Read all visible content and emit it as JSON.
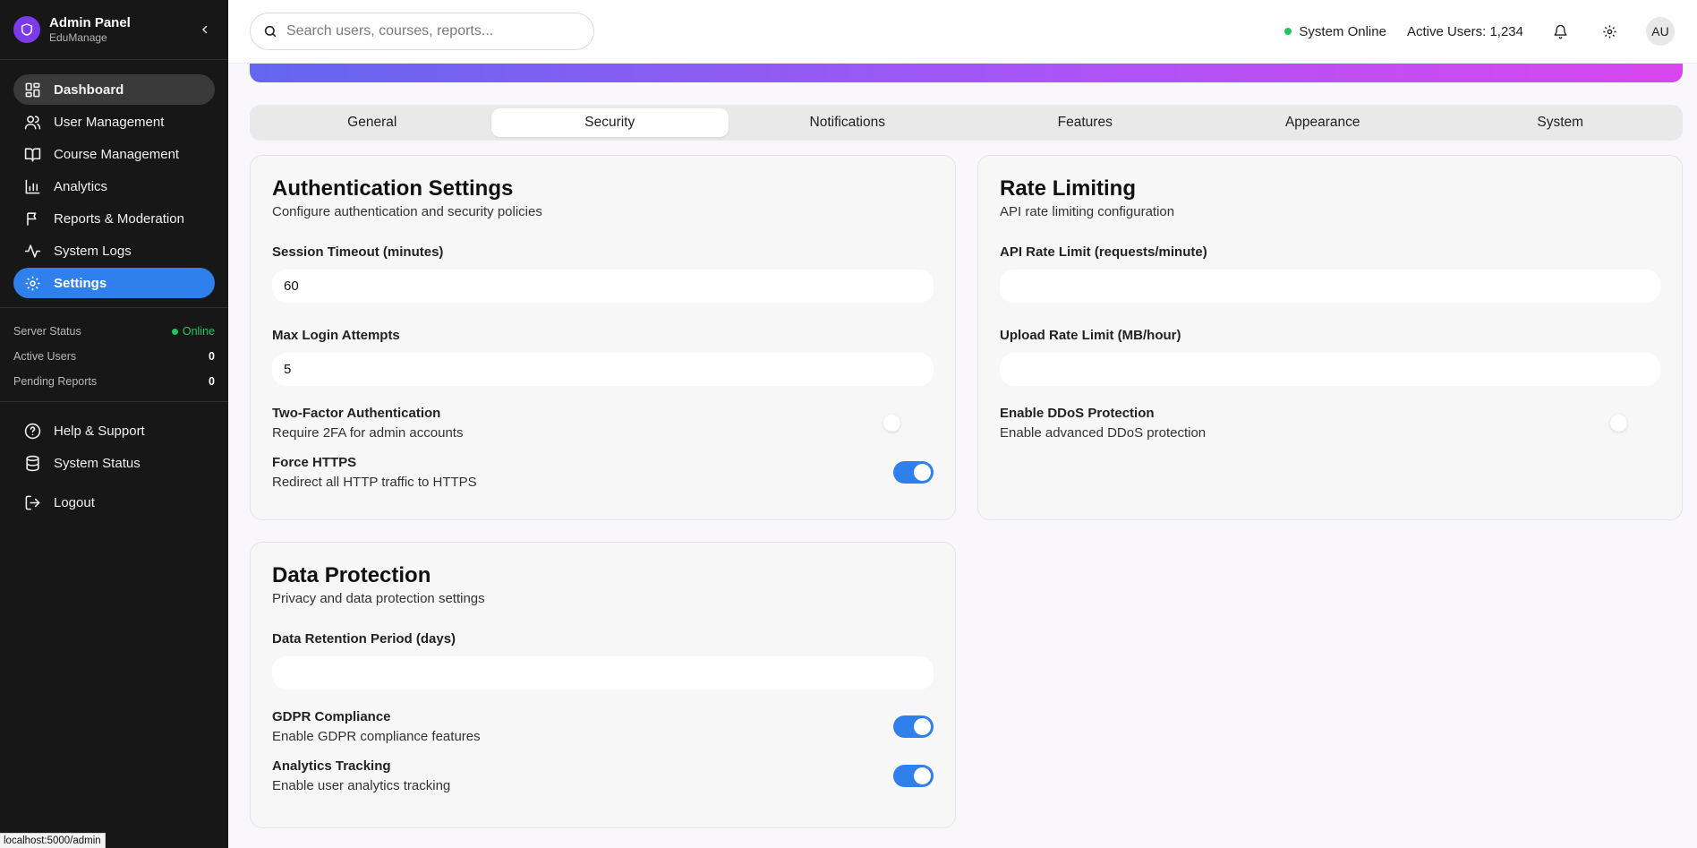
{
  "brand": {
    "title": "Admin Panel",
    "subtitle": "EduManage"
  },
  "sidebar": {
    "items": [
      {
        "label": "Dashboard"
      },
      {
        "label": "User Management"
      },
      {
        "label": "Course Management"
      },
      {
        "label": "Analytics"
      },
      {
        "label": "Reports & Moderation"
      },
      {
        "label": "System Logs"
      },
      {
        "label": "Settings"
      }
    ],
    "status": {
      "server_label": "Server Status",
      "server_value": "Online",
      "active_label": "Active Users",
      "active_value": "0",
      "pending_label": "Pending Reports",
      "pending_value": "0"
    },
    "bottom": [
      {
        "label": "Help & Support"
      },
      {
        "label": "System Status"
      },
      {
        "label": "Logout"
      }
    ]
  },
  "statusbar_url": "localhost:5000/admin",
  "topbar": {
    "search_placeholder": "Search users, courses, reports...",
    "system_status": "System Online",
    "active_users": "Active Users: 1,234",
    "avatar_initials": "AU"
  },
  "tabs": [
    {
      "label": "General"
    },
    {
      "label": "Security"
    },
    {
      "label": "Notifications"
    },
    {
      "label": "Features"
    },
    {
      "label": "Appearance"
    },
    {
      "label": "System"
    }
  ],
  "active_tab": "Security",
  "auth": {
    "title": "Authentication Settings",
    "description": "Configure authentication and security policies",
    "session_label": "Session Timeout (minutes)",
    "session_value": "60",
    "attempts_label": "Max Login Attempts",
    "attempts_value": "5",
    "twofa_title": "Two-Factor Authentication",
    "twofa_desc": "Require 2FA for admin accounts",
    "twofa_enabled": false,
    "https_title": "Force HTTPS",
    "https_desc": "Redirect all HTTP traffic to HTTPS",
    "https_enabled": true
  },
  "rate": {
    "title": "Rate Limiting",
    "description": "API rate limiting configuration",
    "api_label": "API Rate Limit (requests/minute)",
    "api_value": "",
    "upload_label": "Upload Rate Limit (MB/hour)",
    "upload_value": "",
    "ddos_title": "Enable DDoS Protection",
    "ddos_desc": "Enable advanced DDoS protection",
    "ddos_enabled": false
  },
  "privacy": {
    "title": "Data Protection",
    "description": "Privacy and data protection settings",
    "retention_label": "Data Retention Period (days)",
    "retention_value": "",
    "gdpr_title": "GDPR Compliance",
    "gdpr_desc": "Enable GDPR compliance features",
    "gdpr_enabled": true,
    "analytics_title": "Analytics Tracking",
    "analytics_desc": "Enable user analytics tracking",
    "analytics_enabled": true
  },
  "colors": {
    "accent": "#2f80ed",
    "online": "#22c55e",
    "sidebar_bg": "#171717",
    "brand": "#7c3aed"
  }
}
